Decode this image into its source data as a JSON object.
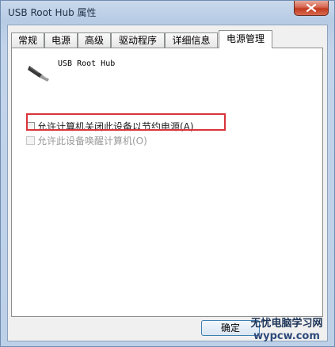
{
  "window": {
    "title": "USB Root Hub 属性"
  },
  "tabs": [
    {
      "label": "常规"
    },
    {
      "label": "电源"
    },
    {
      "label": "高级"
    },
    {
      "label": "驱动程序"
    },
    {
      "label": "详细信息"
    },
    {
      "label": "电源管理"
    }
  ],
  "panel": {
    "device_name": "USB Root Hub",
    "option_allow_turn_off": "允许计算机关闭此设备以节约电源(A)",
    "option_allow_wake": "允许此设备唤醒计算机(O)"
  },
  "buttons": {
    "ok": "确定"
  },
  "watermark": {
    "line1": "无忧电脑学习网",
    "line2": "wypcw.com"
  },
  "colors": {
    "highlight_border": "#d9333a",
    "title_bar": "#b6cbe4"
  },
  "icons": {
    "device": "usb-plug-icon",
    "close": "close-icon"
  }
}
